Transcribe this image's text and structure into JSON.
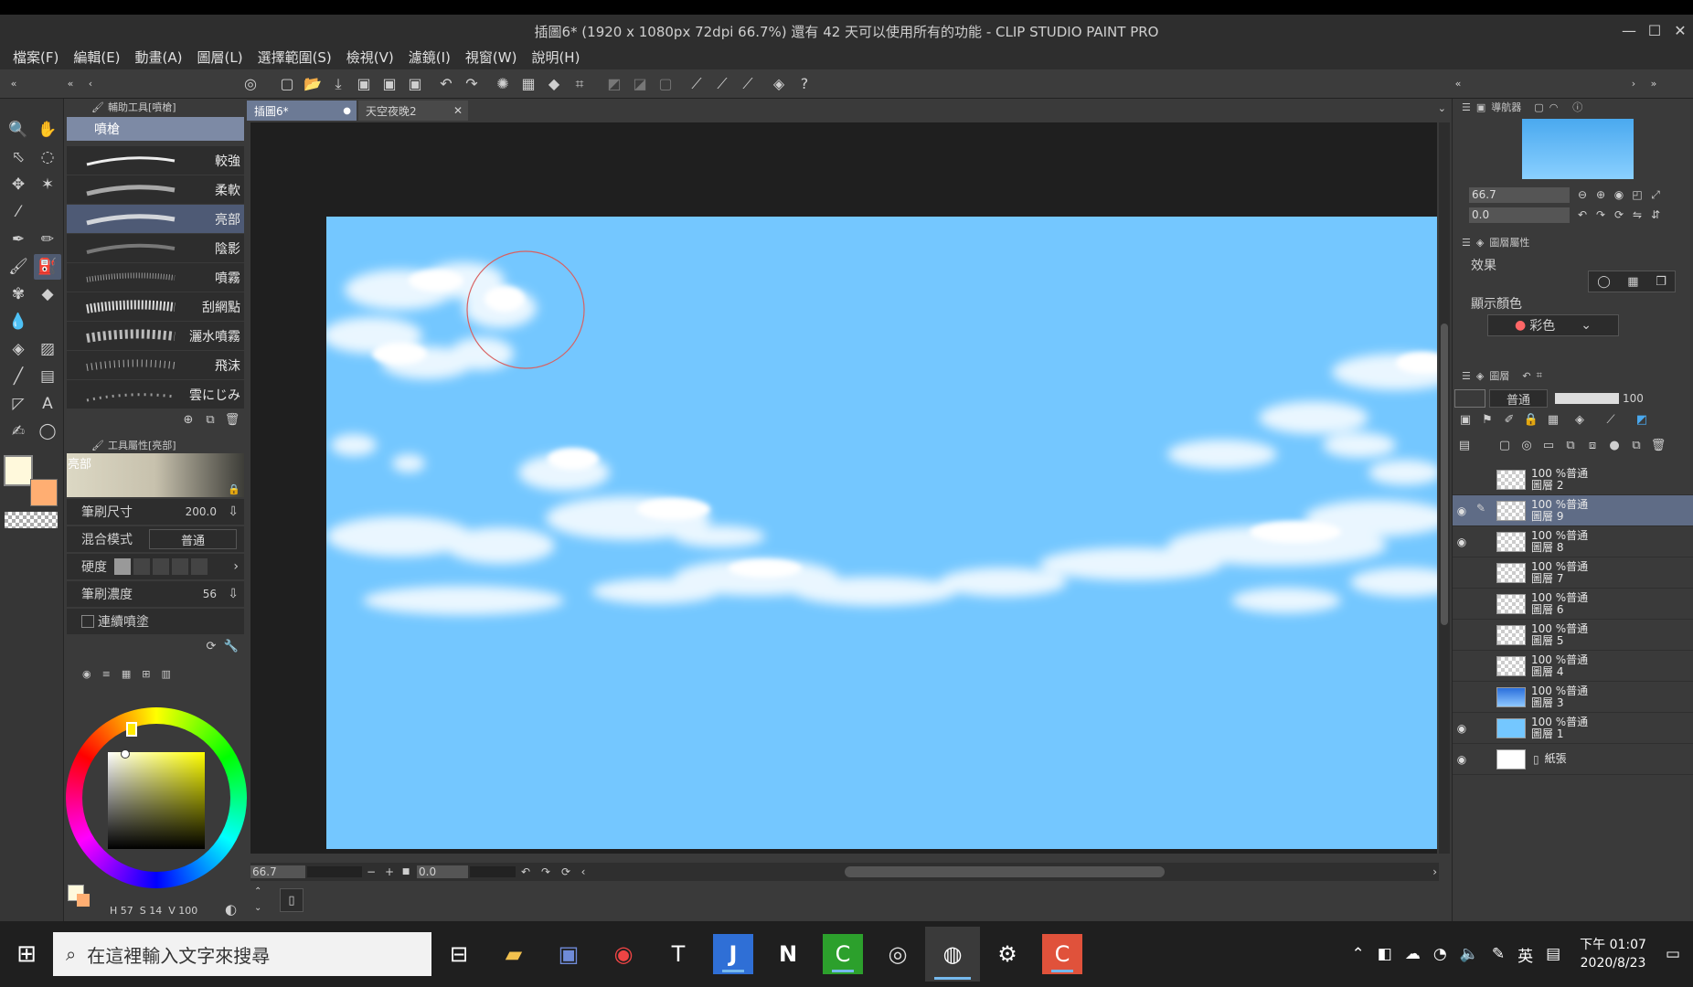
{
  "window": {
    "title": "插圖6* (1920 x 1080px 72dpi 66.7%)  還有 42 天可以使用所有的功能 - CLIP STUDIO PAINT PRO"
  },
  "menu": [
    "檔案(F)",
    "編輯(E)",
    "動畫(A)",
    "圖層(L)",
    "選擇範圍(S)",
    "檢視(V)",
    "濾鏡(I)",
    "視窗(W)",
    "說明(H)"
  ],
  "subtool": {
    "panel_title": "輔助工具[噴槍]",
    "group": "噴槍",
    "brushes": [
      "較強",
      "柔軟",
      "亮部",
      "陰影",
      "噴霧",
      "刮網點",
      "灑水噴霧",
      "飛沫",
      "雲にじみ"
    ]
  },
  "toolprop": {
    "panel_title": "工具屬性[亮部]",
    "preview_label": "亮部",
    "brush_size_label": "筆刷尺寸",
    "brush_size": "200.0",
    "blend_label": "混合模式",
    "blend_value": "普通",
    "hardness_label": "硬度",
    "density_label": "筆刷濃度",
    "density": "56",
    "continuous_label": "連續噴塗"
  },
  "color": {
    "status_h": "H",
    "h": "57",
    "status_s": "S",
    "s": "14",
    "status_v": "V",
    "v": "100",
    "fg": "#fff9dc",
    "bg": "#ffae72"
  },
  "tabs": [
    {
      "label": "插圖6*"
    },
    {
      "label": "天空夜晚2"
    }
  ],
  "canvas": {
    "zoom": "66.7",
    "angle": "0.0",
    "color": "#74c7ff"
  },
  "navigator": {
    "title": "導航器",
    "zoom": "66.7",
    "angle": "0.0"
  },
  "layerprop": {
    "title": "圖層屬性",
    "effect_label": "效果",
    "display_color_label": "顯示顏色",
    "display_color_value": "彩色"
  },
  "layers": {
    "title": "圖層",
    "blend": "普通",
    "opacity": "100",
    "items": [
      {
        "pct": "100 %普通",
        "name": "圖層 2",
        "visible": "",
        "sel": false
      },
      {
        "pct": "100 %普通",
        "name": "圖層 9",
        "visible": "◉",
        "sel": true
      },
      {
        "pct": "100 %普通",
        "name": "圖層 8",
        "visible": "◉",
        "sel": false
      },
      {
        "pct": "100 %普通",
        "name": "圖層 7",
        "visible": "",
        "sel": false
      },
      {
        "pct": "100 %普通",
        "name": "圖層 6",
        "visible": "",
        "sel": false
      },
      {
        "pct": "100 %普通",
        "name": "圖層 5",
        "visible": "",
        "sel": false
      },
      {
        "pct": "100 %普通",
        "name": "圖層 4",
        "visible": "",
        "sel": false
      },
      {
        "pct": "100 %普通",
        "name": "圖層 3",
        "visible": "",
        "sel": false
      },
      {
        "pct": "100 %普通",
        "name": "圖層 1",
        "visible": "◉",
        "sel": false
      }
    ],
    "paper": {
      "name": "紙張",
      "visible": "◉"
    }
  },
  "taskbar": {
    "search_placeholder": "在這裡輸入文字來搜尋",
    "ime": "英",
    "time": "下午 01:07",
    "date": "2020/8/23"
  }
}
